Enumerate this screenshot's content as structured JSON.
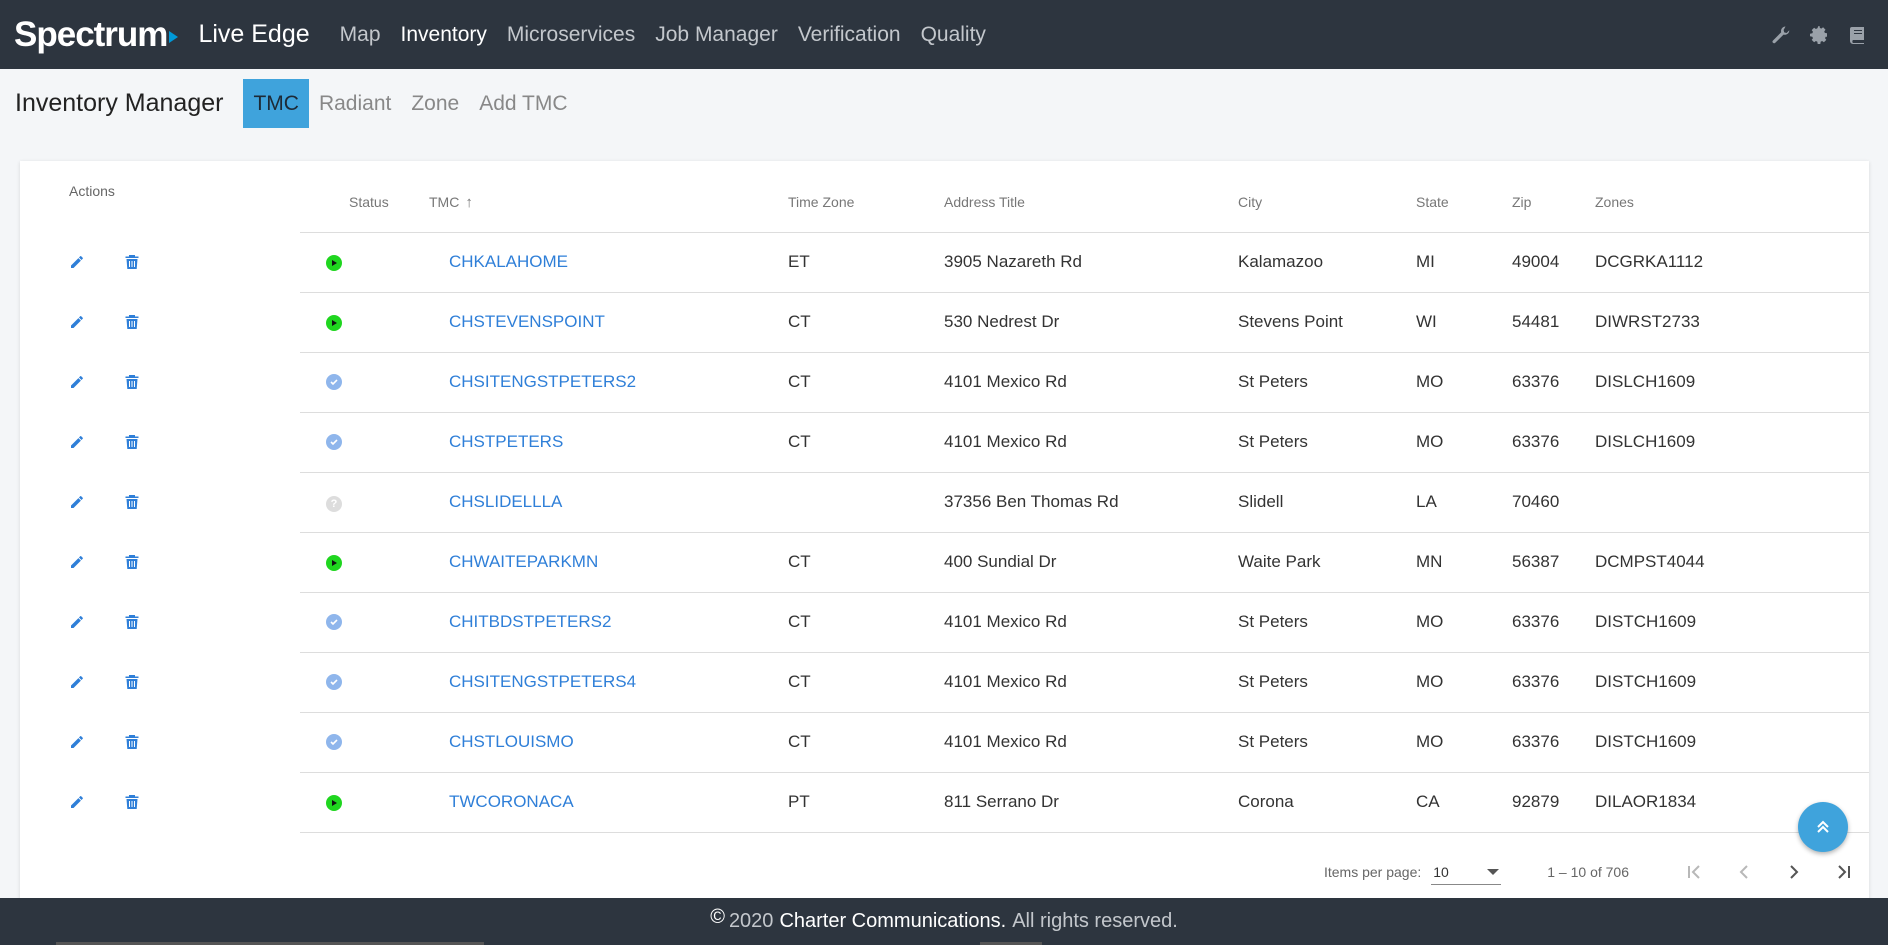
{
  "brand": {
    "logo": "Spectrum",
    "app": "Live Edge"
  },
  "nav": [
    "Map",
    "Inventory",
    "Microservices",
    "Job Manager",
    "Verification",
    "Quality"
  ],
  "nav_active": "Inventory",
  "tools": [
    "wrench-icon",
    "gear-icon",
    "book-icon"
  ],
  "page": {
    "title": "Inventory Manager",
    "tabs": [
      "TMC",
      "Radiant",
      "Zone",
      "Add TMC"
    ],
    "active_tab": "TMC"
  },
  "table": {
    "actions_header": "Actions",
    "columns": [
      "Status",
      "TMC",
      "Time Zone",
      "Address Title",
      "City",
      "State",
      "Zip",
      "Zones"
    ],
    "rows": [
      {
        "status": "active",
        "tmc": "CHKALAHOME",
        "tz": "ET",
        "address": "3905 Nazareth Rd",
        "city": "Kalamazoo",
        "state": "MI",
        "zip": "49004",
        "zones": "DCGRKA1112"
      },
      {
        "status": "active",
        "tmc": "CHSTEVENSPOINT",
        "tz": "CT",
        "address": "530 Nedrest Dr",
        "city": "Stevens Point",
        "state": "WI",
        "zip": "54481",
        "zones": "DIWRST2733"
      },
      {
        "status": "verified",
        "tmc": "CHSITENGSTPETERS2",
        "tz": "CT",
        "address": "4101 Mexico Rd",
        "city": "St Peters",
        "state": "MO",
        "zip": "63376",
        "zones": "DISLCH1609"
      },
      {
        "status": "verified",
        "tmc": "CHSTPETERS",
        "tz": "CT",
        "address": "4101 Mexico Rd",
        "city": "St Peters",
        "state": "MO",
        "zip": "63376",
        "zones": "DISLCH1609"
      },
      {
        "status": "unknown",
        "tmc": "CHSLIDELLLA",
        "tz": "",
        "address": "37356 Ben Thomas Rd",
        "city": "Slidell",
        "state": "LA",
        "zip": "70460",
        "zones": ""
      },
      {
        "status": "active",
        "tmc": "CHWAITEPARKMN",
        "tz": "CT",
        "address": "400 Sundial Dr",
        "city": "Waite Park",
        "state": "MN",
        "zip": "56387",
        "zones": "DCMPST4044"
      },
      {
        "status": "verified",
        "tmc": "CHITBDSTPETERS2",
        "tz": "CT",
        "address": "4101 Mexico Rd",
        "city": "St Peters",
        "state": "MO",
        "zip": "63376",
        "zones": "DISTCH1609"
      },
      {
        "status": "verified",
        "tmc": "CHSITENGSTPETERS4",
        "tz": "CT",
        "address": "4101 Mexico Rd",
        "city": "St Peters",
        "state": "MO",
        "zip": "63376",
        "zones": "DISTCH1609"
      },
      {
        "status": "verified",
        "tmc": "CHSTLOUISMO",
        "tz": "CT",
        "address": "4101 Mexico Rd",
        "city": "St Peters",
        "state": "MO",
        "zip": "63376",
        "zones": "DISTCH1609"
      },
      {
        "status": "active",
        "tmc": "TWCORONACA",
        "tz": "PT",
        "address": "811 Serrano Dr",
        "city": "Corona",
        "state": "CA",
        "zip": "92879",
        "zones": "DILAOR1834"
      }
    ]
  },
  "paginator": {
    "items_per_page_label": "Items per page:",
    "items_per_page": "10",
    "range": "1 – 10 of 706"
  },
  "footer": {
    "copyright_symbol": "©",
    "year": "2020",
    "company": "Charter Communications.",
    "rights": "All rights reserved."
  },
  "colors": {
    "nav_bg": "#2d353f",
    "accent": "#3fa3dc",
    "link": "#2f7fd8",
    "status_active": "#1fd61f",
    "status_verified": "#8fb6ec",
    "status_unknown": "#dddddd"
  }
}
